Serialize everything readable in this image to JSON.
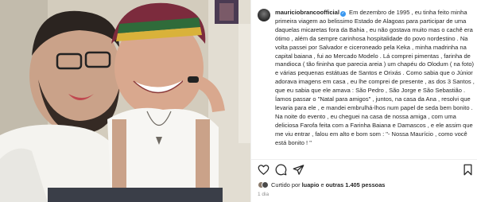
{
  "post": {
    "username": "mauriciobrancoofficial",
    "caption": "Em dezembro de 1995 , eu tinha feito minha primeira viagem ao belissimo Estado de Alagoas para participar de uma daquelas micaretas fora da Bahia , eu não gostava muito mas o cachê era ótimo , além da sempre carinhosa hospitalidade do povo nordestino . Na volta passei por Salvador e ciceroneado pela Keka , minha madrinha na capital baiana , fui ao Mercado Modelo . Lá comprei pimentas , farinha de mandioca ( tão fininha que parecia areia ) um chapéu do Olodum ( na foto) e várias pequenas estátuas de Santos e Orixás . Como sabia que o Júnior adorava imagens em casa , eu lhe comprei de presente , as dos 3 Santos , que eu sabia que ele amava : São Pedro , São Jorge e São Sebastião . Íamos passar o \"Natal para amigos\" , juntos, na casa da Ana , resolvi que levaria para ele , e mandei embrulhá-lhos num papel de seda bem bonito . Na noite do evento , eu cheguei na casa de nossa amiga , com uma deliciosa Farofa feita com a Farinha Baiana e Damascos , e ele assim que me viu entrar , falou em alto e bom som : \"- Nossa Maurício , como você está bonito ! \"",
    "verified": true
  },
  "likes": {
    "prefix": "Curtido por",
    "first_user": "luapio",
    "connector": "e",
    "others": "outras 1.405 pessoas"
  },
  "timestamp": "1 dia",
  "icons": {
    "like": "heart-icon",
    "comment": "comment-icon",
    "share": "share-icon",
    "save": "bookmark-icon"
  }
}
